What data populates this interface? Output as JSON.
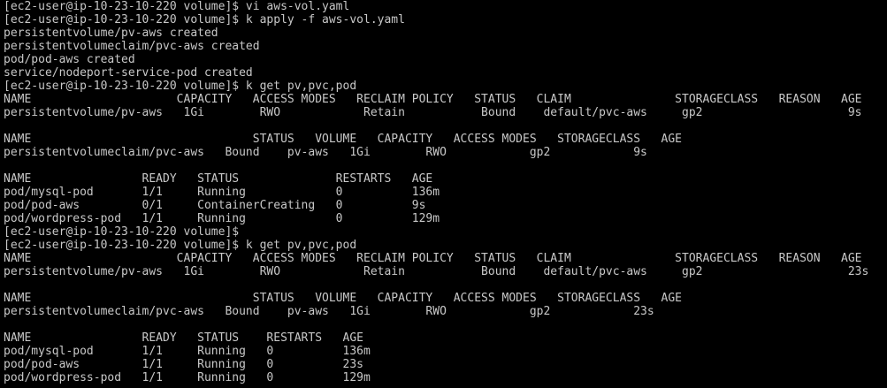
{
  "terminal": {
    "foreground": "#c8c8c8",
    "background": "#000000",
    "lines": [
      "[ec2-user@ip-10-23-10-220 volume]$ vi aws-vol.yaml",
      "[ec2-user@ip-10-23-10-220 volume]$ k apply -f aws-vol.yaml",
      "persistentvolume/pv-aws created",
      "persistentvolumeclaim/pvc-aws created",
      "pod/pod-aws created",
      "service/nodeport-service-pod created",
      "[ec2-user@ip-10-23-10-220 volume]$ k get pv,pvc,pod",
      "NAME                     CAPACITY   ACCESS MODES   RECLAIM POLICY   STATUS   CLAIM               STORAGECLASS   REASON   AGE",
      "persistentvolume/pv-aws   1Gi        RWO            Retain           Bound    default/pvc-aws     gp2                     9s",
      "",
      "NAME                                STATUS   VOLUME   CAPACITY   ACCESS MODES   STORAGECLASS   AGE",
      "persistentvolumeclaim/pvc-aws   Bound    pv-aws   1Gi        RWO            gp2            9s",
      "",
      "NAME                READY   STATUS              RESTARTS   AGE",
      "pod/mysql-pod       1/1     Running             0          136m",
      "pod/pod-aws         0/1     ContainerCreating   0          9s",
      "pod/wordpress-pod   1/1     Running             0          129m",
      "[ec2-user@ip-10-23-10-220 volume]$",
      "[ec2-user@ip-10-23-10-220 volume]$ k get pv,pvc,pod",
      "NAME                     CAPACITY   ACCESS MODES   RECLAIM POLICY   STATUS   CLAIM               STORAGECLASS   REASON   AGE",
      "persistentvolume/pv-aws   1Gi        RWO            Retain           Bound    default/pvc-aws     gp2                     23s",
      "",
      "NAME                                STATUS   VOLUME   CAPACITY   ACCESS MODES   STORAGECLASS   AGE",
      "persistentvolumeclaim/pvc-aws   Bound    pv-aws   1Gi        RWO            gp2            23s",
      "",
      "NAME                READY   STATUS    RESTARTS   AGE",
      "pod/mysql-pod       1/1     Running   0          136m",
      "pod/pod-aws         1/1     Running   0          23s",
      "pod/wordpress-pod   1/1     Running   0          129m"
    ]
  }
}
